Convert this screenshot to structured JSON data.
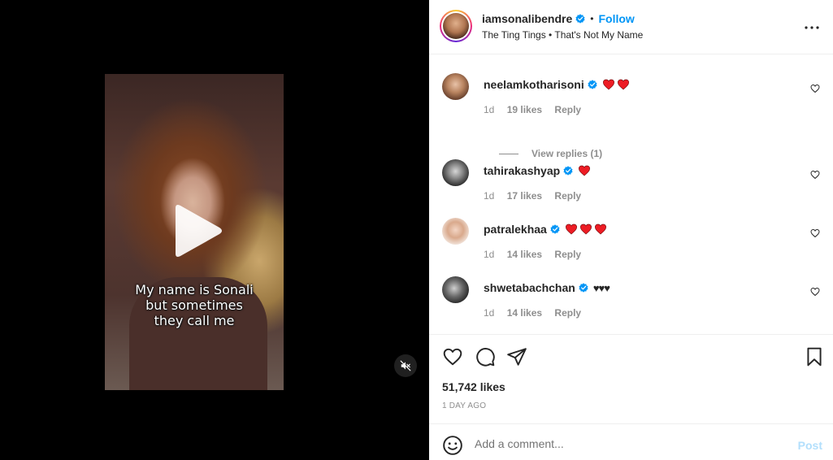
{
  "video": {
    "caption_lines": [
      "My name is Sonali",
      "but sometimes",
      "they call me"
    ],
    "play_icon": "play-icon",
    "mute_icon": "audio-muted-icon"
  },
  "post": {
    "username": "iamsonalibendre",
    "follow_label": "Follow",
    "separator": "•",
    "audio": "The Ting Tings • That's Not My Name",
    "verified_icon": "verified-badge-icon",
    "more_icon": "more-options-icon"
  },
  "comments": [
    {
      "username": "neelamkotharisoni",
      "verified": true,
      "hearts": 2,
      "text": "",
      "time": "1d",
      "likes": "19 likes",
      "reply": "Reply",
      "view_replies": "View replies (1)"
    },
    {
      "username": "tahirakashyap",
      "verified": true,
      "hearts": 1,
      "text": "",
      "time": "1d",
      "likes": "17 likes",
      "reply": "Reply"
    },
    {
      "username": "patralekhaa",
      "verified": true,
      "hearts": 3,
      "text": "",
      "time": "1d",
      "likes": "14 likes",
      "reply": "Reply"
    },
    {
      "username": "shwetabachchan",
      "verified": true,
      "hearts": 0,
      "text": "♥♥♥",
      "time": "1d",
      "likes": "14 likes",
      "reply": "Reply"
    }
  ],
  "actions": {
    "likes": "51,742 likes",
    "time_ago": "1 DAY AGO",
    "icons": [
      "heart-icon",
      "comment-icon",
      "share-icon",
      "bookmark-icon"
    ]
  },
  "add_comment": {
    "placeholder": "Add a comment...",
    "post_label": "Post",
    "emoji_icon": "emoji-icon"
  },
  "colors": {
    "accent": "#0095f6",
    "heart_red": "#ed1c24",
    "muted_text": "#8e8e8e",
    "post_disabled": "#b2dffc"
  }
}
